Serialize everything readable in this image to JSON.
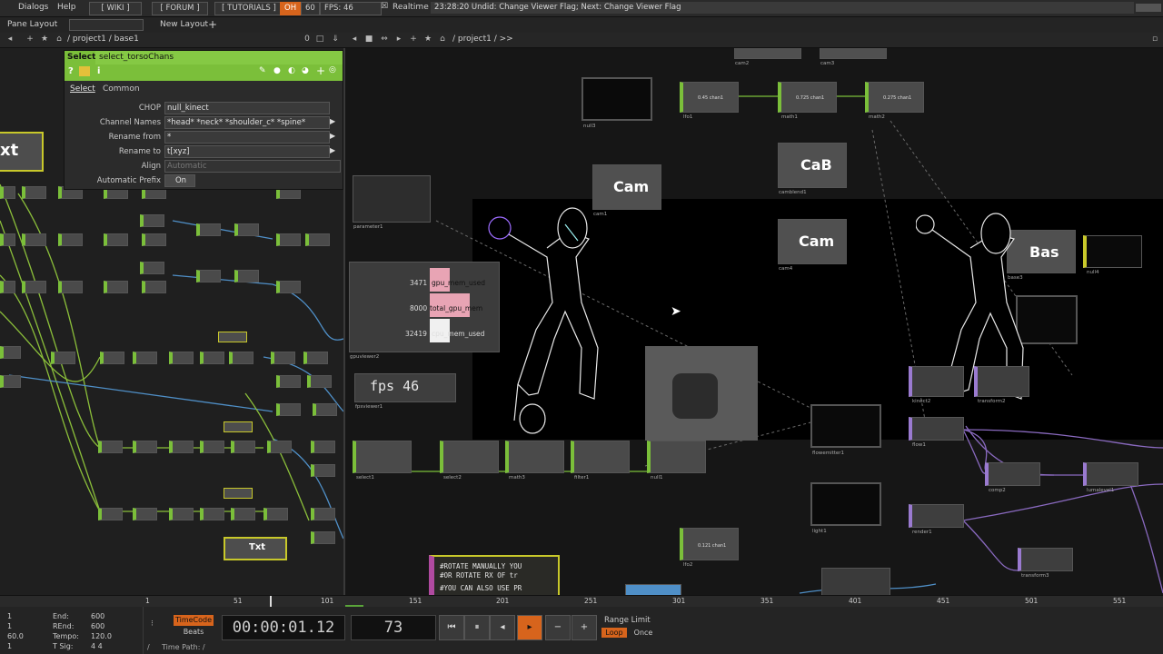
{
  "menubar": {
    "dialogs": "Dialogs",
    "help": "Help",
    "wiki": "[ WIKI ]",
    "forum": "[ FORUM ]",
    "tutorials": "[ TUTORIALS ]",
    "oh": "OH",
    "fps_cap": "60",
    "fps": "FPS: 46",
    "realtime": "Realtime",
    "status": "23:28:20 Undid: Change Viewer Flag; Next: Change Viewer Flag"
  },
  "panebar": {
    "pane_layout": "Pane Layout",
    "new_layout": "New Layout"
  },
  "pathbar": {
    "left_path": "/ project1 / base1",
    "right_path": "/ project1 / >>"
  },
  "param": {
    "op_type": "Select",
    "op_name": "select_torsoChans",
    "tab_select": "Select",
    "tab_common": "Common",
    "rows": [
      {
        "label": "CHOP",
        "value": "null_kinect"
      },
      {
        "label": "Channel Names",
        "value": "*head* *neck* *shoulder_c* *spine*"
      },
      {
        "label": "Rename from",
        "value": "*"
      },
      {
        "label": "Rename to",
        "value": "t[xyz]"
      },
      {
        "label": "Align",
        "value": "Automatic"
      },
      {
        "label": "Automatic Prefix",
        "value": "On"
      }
    ]
  },
  "left_nodes": {
    "txt_big": "xt",
    "txt_small": "Txt"
  },
  "right_nodes": {
    "cam1": "Cam",
    "cam1_name": "cam1",
    "cab": "CaB",
    "cab_name": "camblend1",
    "cam4": "Cam",
    "cam4_name": "cam4",
    "bas": "Bas",
    "bas_name": "base3",
    "null4_name": "null4",
    "null3_name": "null3",
    "cam2_name": "cam2",
    "cam3_name": "cam3",
    "lfo1_name": "lfo1",
    "math1_name": "math1",
    "math2_name": "math2",
    "lfo1_val": "0.45 chan1",
    "math1_val": "0.725 chan1",
    "math2_val": "0.275 chan1",
    "parameter1_name": "parameter1",
    "gpuviewer2_name": "gpuviewer2",
    "gpu_rows": [
      {
        "num": "3471",
        "label": "gpu_mem_used"
      },
      {
        "num": "8000",
        "label": "total_gpu_mem"
      },
      {
        "num": "32419",
        "label": "cpu_mem_used"
      }
    ],
    "fps_text": "fps 46",
    "fpsviewer_name": "fpsviewer1",
    "select1_name": "select1",
    "select2_name": "select2",
    "math3_name": "math3",
    "filter1_name": "filter1",
    "null1_name": "null1",
    "flowemitter_name": "flowemitter1",
    "flow1_name": "flow1",
    "kinect2_name": "kinect2",
    "transform2_name": "transform2",
    "comp2_name": "comp2",
    "lumalevel1_name": "lumalevel1",
    "light1_name": "light1",
    "render1_name": "render1",
    "transform3_name": "transform3",
    "lfo2_name": "lfo2",
    "lfo2_val": "0.121 chan1",
    "script_line1": "#ROTATE MANUALLY YOU",
    "script_line2": "#OR ROTATE RX OF tr",
    "script_line3": "#YOU CAN ALSO USE PR"
  },
  "timeline": {
    "ticks": [
      "1",
      "51",
      "101",
      "151",
      "201",
      "251",
      "301",
      "351",
      "401",
      "451",
      "501",
      "551"
    ]
  },
  "bottom": {
    "start": "1",
    "rstart": "1",
    "fps_val": "60.0",
    "tsig_a": "1",
    "end_label": "End:",
    "end_val": "600",
    "rend_label": "REnd:",
    "rend_val": "600",
    "tempo_label": "Tempo:",
    "tempo_val": "120.0",
    "tsig_label": "T Sig:",
    "tsig_val": "4    4",
    "timecode": "TimeCode",
    "beats": "Beats",
    "time": "00:00:01.12",
    "frame": "73",
    "range_limit": "Range Limit",
    "loop": "Loop",
    "once": "Once",
    "time_path": "Time Path: /"
  },
  "colors": {
    "chop_green": "#7bbf3a",
    "top_purple": "#9a7ad0",
    "accent_orange": "#d7641c",
    "dat_yellow": "#c8c82a"
  }
}
